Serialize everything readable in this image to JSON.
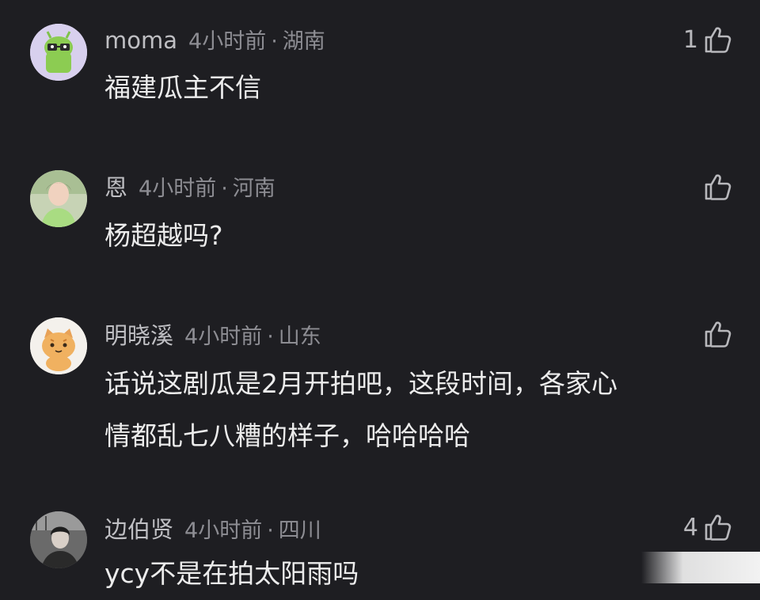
{
  "comments": [
    {
      "username": "moma",
      "time": "4小时前",
      "separator": "·",
      "location": "湖南",
      "text": "福建瓜主不信",
      "likes": "1",
      "avatar_icon": "green-android-robot-avatar"
    },
    {
      "username": "恩",
      "time": "4小时前",
      "separator": "·",
      "location": "河南",
      "text": "杨超越吗?",
      "likes": "",
      "avatar_icon": "woman-photo-avatar"
    },
    {
      "username": "明晓溪",
      "time": "4小时前",
      "separator": "·",
      "location": "山东",
      "text": "话说这剧瓜是2月开拍吧，这段时间，各家心\n情都乱七八糟的样子，哈哈哈哈",
      "likes": "",
      "avatar_icon": "cartoon-cat-avatar"
    },
    {
      "username": "边伯贤",
      "time": "4小时前",
      "separator": "·",
      "location": "四川",
      "text": "ycy不是在拍太阳雨吗",
      "likes": "4",
      "avatar_icon": "man-photo-avatar"
    }
  ],
  "colors": {
    "background": "#1e1e22",
    "username": "#bfbfc3",
    "meta": "#8d8d93",
    "text": "#ececec"
  }
}
